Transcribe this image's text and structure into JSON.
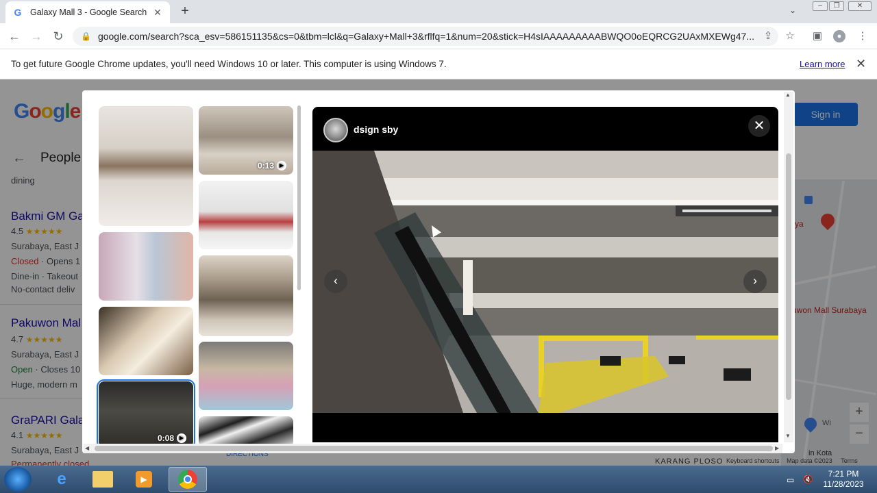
{
  "browser": {
    "tab_title": "Galaxy Mall 3 - Google Search",
    "tab_favicon": "G",
    "url": "google.com/search?sca_esv=586151135&cs=0&tbm=lcl&q=Galaxy+Mall+3&rflfq=1&num=20&stick=H4sIAAAAAAAAABWQO0oEQRCG2UAxMXEWg47..."
  },
  "infobar": {
    "message": "To get future Google Chrome updates, you'll need Windows 10 or later. This computer is using Windows 7.",
    "link": "Learn more"
  },
  "background_page": {
    "people_also": "People a",
    "listing_prefix": "dining",
    "sign_in": "Sign in",
    "listings": [
      {
        "name": "Bakmi GM Ga",
        "rating": "4.5",
        "line2": "Surabaya, East J",
        "status": "Closed",
        "status_rest": " · Opens 1",
        "line4": "Dine-in · Takeout",
        "line5": "No-contact deliv"
      },
      {
        "name": "Pakuwon Mal",
        "rating": "4.7",
        "line2": "Surabaya, East J",
        "status": "Open",
        "status_rest": " · Closes 10",
        "line4": "Huge, modern m",
        "line5": ""
      },
      {
        "name": "GraPARI Gala",
        "rating": "4.1",
        "line2": "Surabaya, East J",
        "status": "Permanently closed",
        "status_rest": "",
        "line4": "",
        "line5": ""
      }
    ],
    "map_labels": {
      "surabaya": "abaya",
      "pakuwon": "uwon Mall Surabaya",
      "karang": "KARANG PLOSO",
      "shortcuts": "Keyboard shortcuts",
      "mapdata": "Map data ©2023",
      "terms": "Terms",
      "kota": "in Kota",
      "directions": "DIRECTIONS"
    }
  },
  "viewer": {
    "author": "dsign sby",
    "thumbnails": [
      {
        "duration": ""
      },
      {
        "duration": "0:13"
      },
      {
        "duration": ""
      },
      {
        "duration": ""
      },
      {
        "duration": ""
      },
      {
        "duration": ""
      },
      {
        "duration": ""
      },
      {
        "duration": "0:08"
      },
      {
        "duration": ""
      }
    ]
  },
  "taskbar": {
    "time": "7:21 PM",
    "date": "11/28/2023"
  },
  "colors": {
    "accent": "#1a73e8",
    "closed": "#d93025",
    "link": "#1a0dab"
  }
}
